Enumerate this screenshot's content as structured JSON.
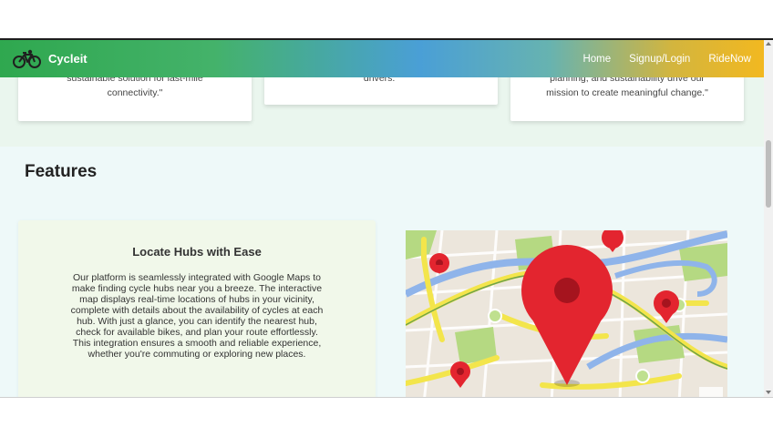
{
  "navbar": {
    "brand": "Cycleit",
    "links": [
      "Home",
      "Signup/Login",
      "RideNow"
    ],
    "gradient_colors": [
      "#2fa84f",
      "#4a9fd6",
      "#f2b820"
    ]
  },
  "testimonials": [
    {
      "line1": "sustainable solution for last-mile",
      "line2": "connectivity.\""
    },
    {
      "line1": "drivers.\""
    },
    {
      "line1": "planning, and sustainability drive our",
      "line2": "mission to create meaningful change.\""
    }
  ],
  "features": {
    "title": "Features",
    "card": {
      "title": "Locate Hubs with Ease",
      "lines": [
        "Our platform is seamlessly integrated with Google Maps to",
        "make finding cycle hubs near you a breeze. The interactive",
        "map displays real-time locations of hubs in your vicinity,",
        "complete with details about the availability of cycles at each",
        "hub. With just a glance, you can identify the nearest hub,",
        "check for available bikes, and plan your route effortlessly.",
        "This integration ensures a smooth and reliable experience,",
        "whether you're commuting or exploring new places."
      ]
    },
    "image_icon": "map-with-location-pins"
  }
}
